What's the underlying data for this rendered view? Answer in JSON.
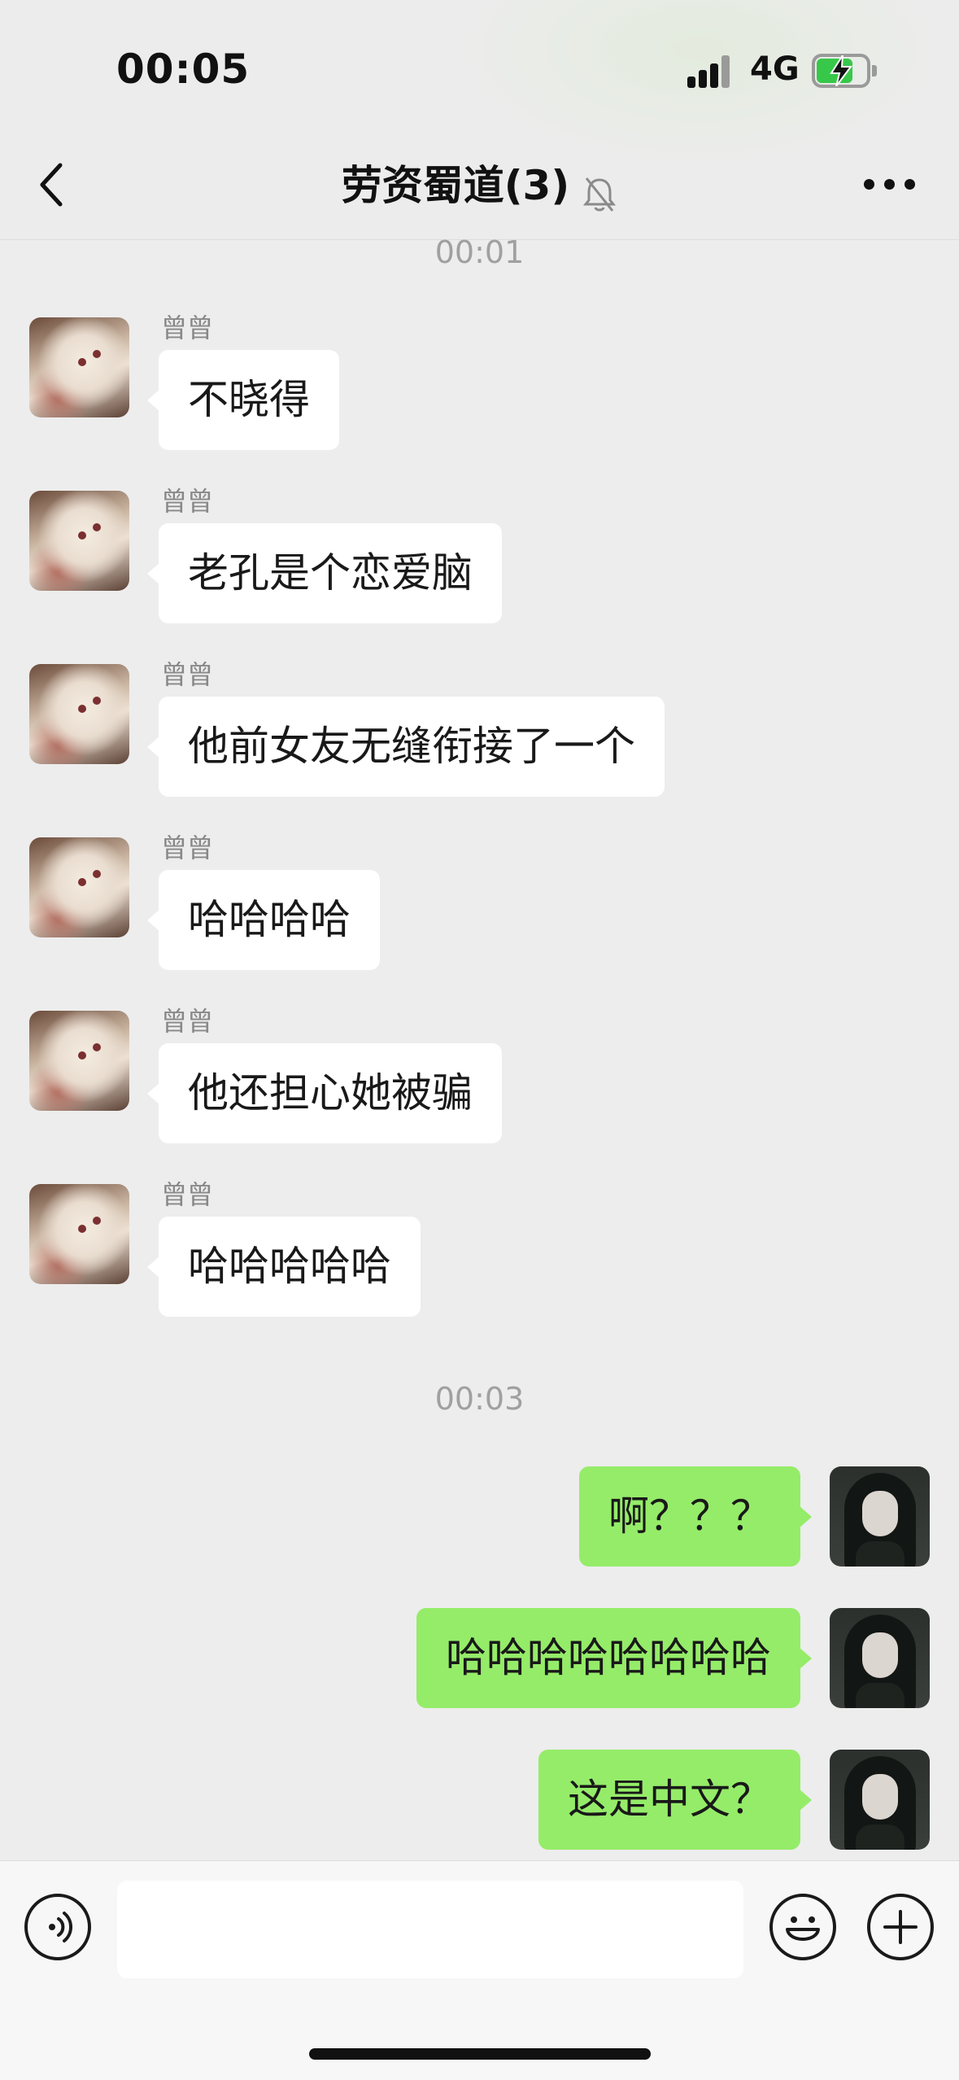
{
  "status_bar": {
    "time": "00:05",
    "network": "4G",
    "icons": [
      "signal-icon",
      "battery-charging-icon"
    ],
    "battery_level": 0.65
  },
  "header": {
    "title": "劳资蜀道(3)",
    "icons": [
      "back-icon",
      "mute-bell-icon",
      "more-icon"
    ]
  },
  "chat": {
    "timestamps": [
      "00:01",
      "00:03"
    ],
    "incoming": [
      {
        "sender": "曾曾",
        "text": "不晓得"
      },
      {
        "sender": "曾曾",
        "text": "老孔是个恋爱脑"
      },
      {
        "sender": "曾曾",
        "text": "他前女友无缝衔接了一个"
      },
      {
        "sender": "曾曾",
        "text": "哈哈哈哈"
      },
      {
        "sender": "曾曾",
        "text": "他还担心她被骗"
      },
      {
        "sender": "曾曾",
        "text": "哈哈哈哈哈"
      }
    ],
    "outgoing": [
      {
        "text": "啊？？？"
      },
      {
        "text": "哈哈哈哈哈哈哈哈"
      },
      {
        "text": "这是中文？"
      }
    ]
  },
  "input_bar": {
    "value": "",
    "icons": [
      "voice-icon",
      "emoji-icon",
      "plus-icon"
    ]
  },
  "colors": {
    "background": "#ededed",
    "incoming_bubble": "#ffffff",
    "outgoing_bubble": "#95ec69",
    "timestamp": "#a0a0a0"
  }
}
